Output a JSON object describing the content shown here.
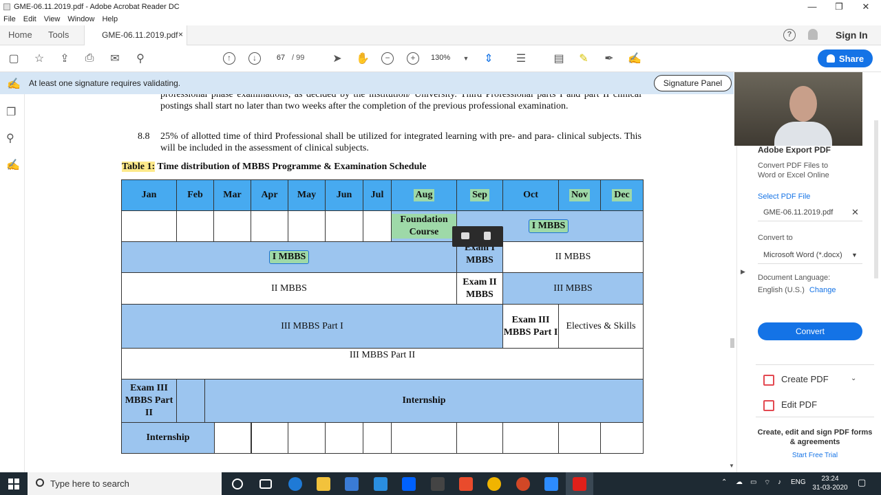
{
  "window": {
    "title": "GME-06.11.2019.pdf - Adobe Acrobat Reader DC",
    "minimize": "—",
    "restore": "❐",
    "close": "✕"
  },
  "menu": [
    "File",
    "Edit",
    "View",
    "Window",
    "Help"
  ],
  "tabs": {
    "home": "Home",
    "tools": "Tools",
    "document": "GME-06.11.2019.pdf",
    "close": "×",
    "help": "?",
    "signin": "Sign In"
  },
  "toolbar": {
    "page_current": "67",
    "page_total": "/ 99",
    "zoom": "130%",
    "share": "Share"
  },
  "signature_bar": {
    "message": "At least one signature requires validating.",
    "panel_button": "Signature Panel"
  },
  "document": {
    "para_top": "professional phase examinations, as decided by the institution/ University. Third Professional parts I and part II clinical postings shall start no later than two weeks after the completion of the previous professional examination.",
    "item_number": "8.8",
    "item_text": "25% of allotted time of third Professional shall be utilized for integrated learning with pre- and para- clinical subjects. This will be included in the assessment of clinical subjects.",
    "caption_label": "Table 1:",
    "caption_text": " Time distribution of MBBS Programme & Examination Schedule",
    "months": [
      "Jan",
      "Feb",
      "Mar",
      "Apr",
      "May",
      "Jun",
      "Jul",
      "Aug",
      "Sep",
      "Oct",
      "Nov",
      "Dec"
    ],
    "cells": {
      "foundation": "Foundation Course",
      "i_mbbs_a": "I MBBS",
      "i_mbbs_b": "I MBBS",
      "exam_i": "Exam I MBBS",
      "ii_mbbs_a": "II MBBS",
      "ii_mbbs_b": "II MBBS",
      "exam_ii": "Exam II MBBS",
      "iii_mbbs_a": "III MBBS",
      "iii_part1": "III MBBS Part I",
      "exam_iii_p1": "Exam III MBBS Part I",
      "electives": "Electives & Skills",
      "iii_part2": "III MBBS Part II",
      "exam_iii_p2": "Exam III MBBS Part II",
      "internship_a": "Internship",
      "internship_b": "Internship"
    }
  },
  "right_panel": {
    "title": "Adobe Export PDF",
    "desc": "Convert PDF Files to Word or Excel Online",
    "select_label": "Select PDF File",
    "selected_file": "GME-06.11.2019.pdf",
    "convert_to_label": "Convert to",
    "convert_to_value": "Microsoft Word (*.docx)",
    "lang_label": "Document Language:",
    "lang_value": "English (U.S.)",
    "lang_change": "Change",
    "convert_button": "Convert",
    "create_pdf": "Create PDF",
    "edit_pdf": "Edit PDF",
    "promo": "Create, edit and sign PDF forms & agreements",
    "trial": "Start Free Trial"
  },
  "taskbar": {
    "search_placeholder": "Type here to search",
    "lang": "ENG",
    "time": "23:24",
    "date": "31-03-2020"
  },
  "colors": {
    "accent": "#1473e6",
    "table_header": "#47aaf0",
    "table_fill": "#9cc5ef",
    "highlight_green": "#9ed9a8",
    "highlight_yellow": "#fde98a"
  }
}
